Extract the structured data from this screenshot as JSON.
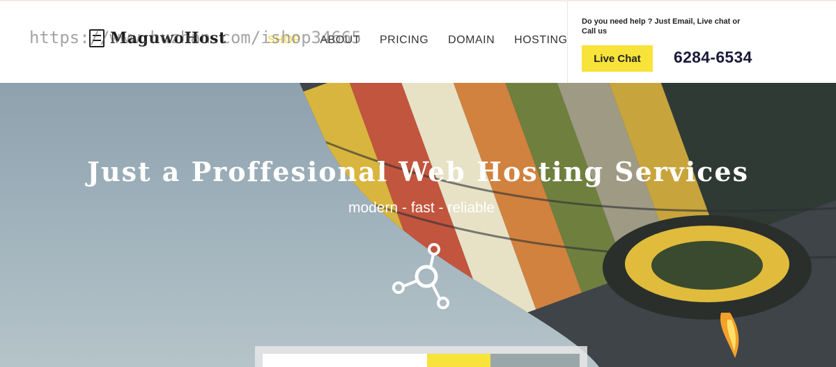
{
  "watermark": "https://www.huzhan.com/ishop34665",
  "logo": {
    "text": "MaguwoHost"
  },
  "nav": {
    "items": [
      {
        "label": "SHOP"
      },
      {
        "label": "ABOUT"
      },
      {
        "label": "PRICING"
      },
      {
        "label": "DOMAIN"
      },
      {
        "label": "HOSTING"
      }
    ]
  },
  "help": {
    "text": "Do you need help ? Just Email, Live chat or Call us",
    "live_chat_label": "Live Chat",
    "phone": "6284-6534"
  },
  "hero": {
    "title": "Just a Proffesional Web Hosting Services",
    "subtitle": "modern - fast - reliable",
    "icon": "share-network-icon"
  },
  "colors": {
    "accent": "#f7e33a",
    "nav_text": "#333333",
    "hero_text": "#ffffff"
  }
}
